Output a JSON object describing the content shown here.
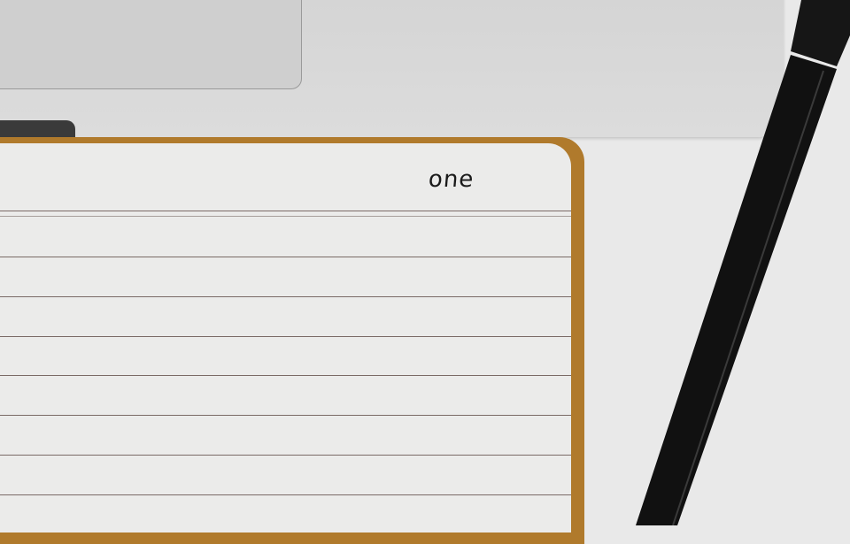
{
  "notebook": {
    "handwritten_text": "one"
  },
  "colors": {
    "background": "#e9e9e9",
    "laptop": "#d8d8d8",
    "notebook_cover": "#b07a2c",
    "page": "#ebebea",
    "pen": "#111111"
  }
}
